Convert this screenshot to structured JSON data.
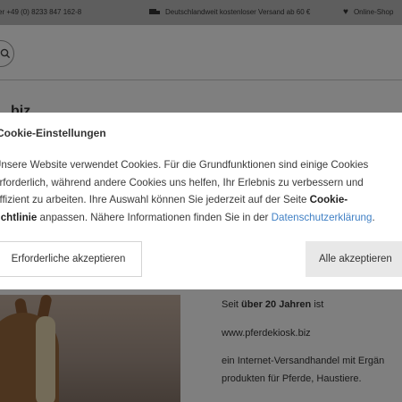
{
  "topbar": {
    "phone": "er +49 (0) 8233 847 162-8",
    "shipping": "Deutschlandweit kostenloser Versand ab 60 €",
    "shop": "Online-Shop"
  },
  "header": {
    "logo_fragment": "biz"
  },
  "about": {
    "line1_pre": "Seit ",
    "line1_bold": "über 20 Jahren",
    "line1_post": " ist",
    "line2": "www.pferdekiosk.biz",
    "line3": "ein Internet-Versandhandel mit Ergän",
    "line4": "produkten für Pferde, Haustiere."
  },
  "cookie": {
    "title": "Cookie-Einstellungen",
    "line1": "Unsere Website verwendet Cookies. Für die Grundfunktionen sind einige Cookies",
    "line2": "erforderlich, während andere Cookies uns helfen, Ihr Erlebnis zu verbessern und",
    "line3": "effizient zu arbeiten. Ihre Auswahl können Sie jederzeit auf der Seite ",
    "line3_bold": "Cookie-",
    "line4_bold": "richtlinie",
    "line4_mid": " anpassen. Nähere Informationen finden Sie in der ",
    "line4_link": "Datenschutzerklärung",
    "line4_end": ".",
    "btn_required": "Erforderliche akzeptieren",
    "btn_all": "Alle akzeptieren"
  },
  "icons": {
    "search": "search-icon",
    "truck": "truck-icon",
    "heart": "heart-icon"
  },
  "colors": {
    "link": "#3f7fc4",
    "overlay": "rgba(0,0,0,0.5)"
  }
}
